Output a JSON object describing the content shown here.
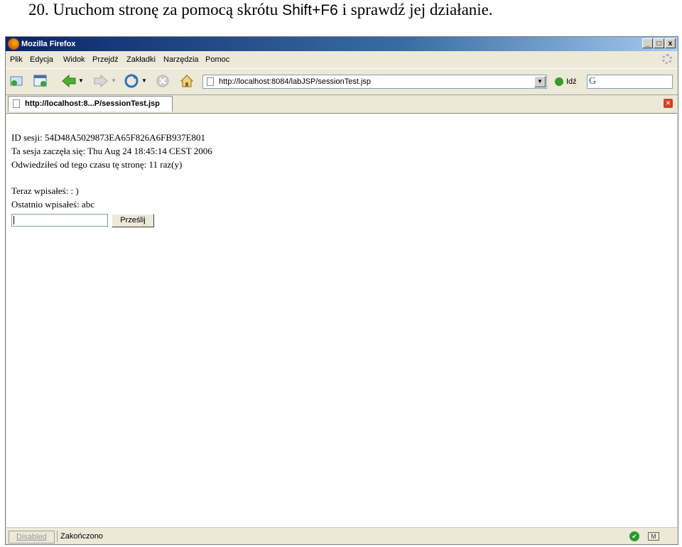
{
  "caption": {
    "part1": "20. Uruchom stronę za pomocą skrótu ",
    "shortcut": "Shift+F6",
    "part2": " i sprawdź jej działanie."
  },
  "window": {
    "title": "Mozilla Firefox",
    "buttons": {
      "minimize": "_",
      "maximize": "□",
      "close": "x"
    }
  },
  "menu": [
    "Plik",
    "Edycja",
    "Widok",
    "Przejdź",
    "Zakładki",
    "Narzędzia",
    "Pomoc"
  ],
  "navbar": {
    "url": "http://localhost:8084/labJSP/sessionTest.jsp",
    "go_label": "Idź",
    "search_logo": "G"
  },
  "tab": {
    "title": "http://localhost:8...P/sessionTest.jsp"
  },
  "content": {
    "session_id": "ID sesji: 54D48A5029873EA65F826A6FB937E801",
    "session_start": "Ta sesja zaczęła się: Thu Aug 24 18:45:14 CEST 2006",
    "visits": "Odwiedziłeś od tego czasu tę stronę: 11 raz(y)",
    "now_typed": "Teraz wpisałeś: : )",
    "last_typed": "Ostatnio wpisałeś: abc",
    "input_value": "",
    "submit_label": "Prześlij"
  },
  "status": {
    "disabled": "Disabled",
    "text": "Zakończono"
  }
}
